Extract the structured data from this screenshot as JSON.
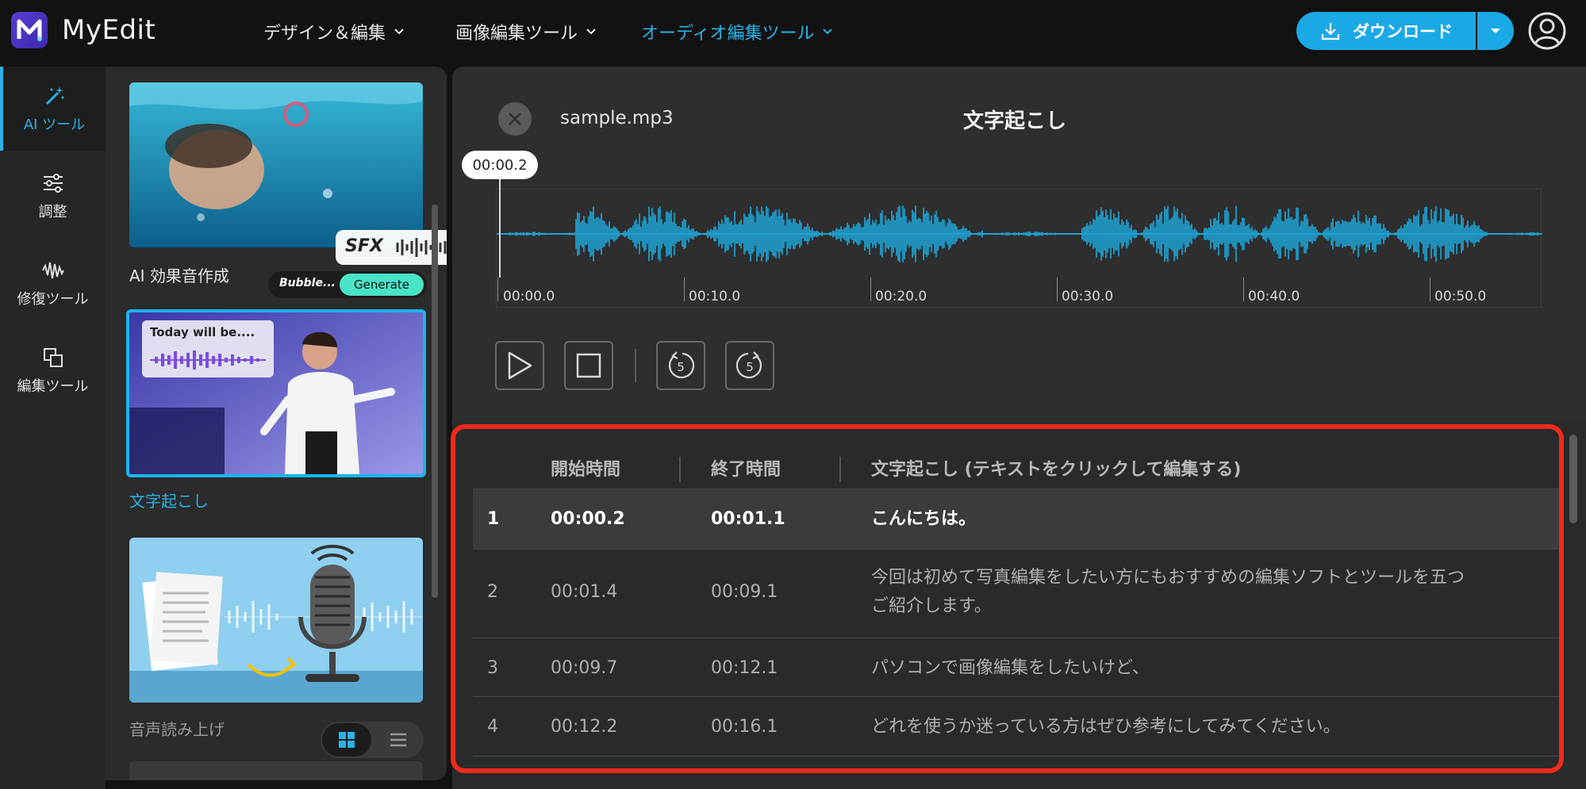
{
  "app": {
    "name": "MyEdit",
    "brand_color": "#1ba9e6",
    "highlight_color": "#ee2a1c"
  },
  "nav": {
    "items": [
      {
        "label": "デザイン＆編集",
        "active": false
      },
      {
        "label": "画像編集ツール",
        "active": false
      },
      {
        "label": "オーディオ編集ツール",
        "active": true
      }
    ]
  },
  "toolbar": {
    "download_label": "ダウンロード"
  },
  "rail": {
    "items": [
      {
        "label": "AI ツール",
        "icon": "magic-wand-icon",
        "active": true
      },
      {
        "label": "調整",
        "icon": "sliders-icon",
        "active": false
      },
      {
        "label": "修復ツール",
        "icon": "waveform-icon",
        "active": false
      },
      {
        "label": "編集ツール",
        "icon": "layers-icon",
        "active": false
      }
    ]
  },
  "tools": {
    "cards": [
      {
        "label": "AI 効果音作成",
        "badge_text": "SFX",
        "input_text": "Bubble...",
        "button_text": "Generate"
      },
      {
        "label": "文字起こし",
        "bubble_text": "Today will be....",
        "active": true
      },
      {
        "label": "音声読み上げ"
      }
    ]
  },
  "player": {
    "filename": "sample.mp3",
    "title": "文字起こし",
    "current_time": "00:00.2",
    "ticks": [
      "00:00.0",
      "00:10.0",
      "00:20.0",
      "00:30.0",
      "00:40.0",
      "00:50.0"
    ],
    "replay_seconds": "5",
    "forward_seconds": "5"
  },
  "transcript": {
    "columns": [
      "開始時間",
      "終了時間",
      "文字起こし (テキストをクリックして編集する)"
    ],
    "rows": [
      {
        "index": "1",
        "start": "00:00.2",
        "end": "00:01.1",
        "text": "こんにちは。",
        "text2": "",
        "selected": true
      },
      {
        "index": "2",
        "start": "00:01.4",
        "end": "00:09.1",
        "text": "今回は初めて写真編集をしたい方にもおすすめの編集ソフトとツールを五つ",
        "text2": "ご紹介します。",
        "selected": false
      },
      {
        "index": "3",
        "start": "00:09.7",
        "end": "00:12.1",
        "text": "パソコンで画像編集をしたいけど、",
        "text2": "",
        "selected": false
      },
      {
        "index": "4",
        "start": "00:12.2",
        "end": "00:16.1",
        "text": "どれを使うか迷っている方はぜひ参考にしてみてください。",
        "text2": "",
        "selected": false
      }
    ]
  }
}
